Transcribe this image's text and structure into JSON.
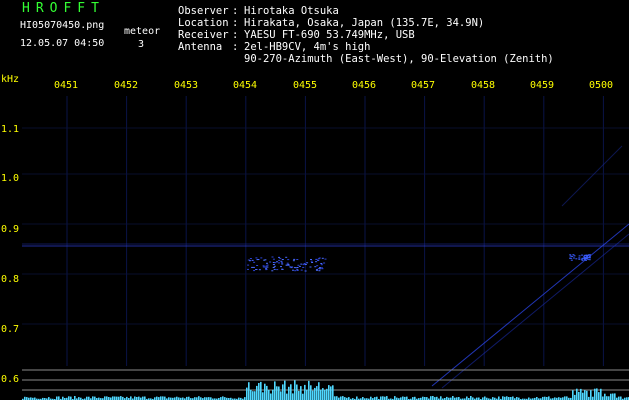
{
  "header": {
    "title": "HROFFT",
    "filename": "HI05070450.png",
    "datetime": "12.05.07 04:50",
    "meteor_label": "meteor",
    "meteor_count": "3"
  },
  "info": [
    {
      "label": "Observer",
      "value": "Hirotaka Otsuka"
    },
    {
      "label": "Location",
      "value": "Hirakata, Osaka, Japan (135.7E, 34.9N)"
    },
    {
      "label": "Receiver",
      "value": "YAESU FT-690 53.749MHz, USB"
    },
    {
      "label": "Antenna",
      "value": "2el-HB9CV, 4m's high"
    },
    {
      "label": "",
      "value": "90-270-Azimuth (East-West), 90-Elevation (Zenith)"
    }
  ],
  "info_separator": ":",
  "axes": {
    "freq_unit": "kHz",
    "time_labels": [
      "0451",
      "0452",
      "0453",
      "0454",
      "0455",
      "0456",
      "0457",
      "0458",
      "0459",
      "0500"
    ],
    "freq_labels": [
      "1.1",
      "1.0",
      "0.9",
      "0.8",
      "0.7",
      "0.6"
    ]
  },
  "colors": {
    "title": "#33ff33",
    "axis_labels": "#ffff00",
    "text": "#ffffff",
    "background": "#000000",
    "grid": "#0a1440",
    "signal": "#3a5cff",
    "meter": "#4fd8ff"
  }
}
